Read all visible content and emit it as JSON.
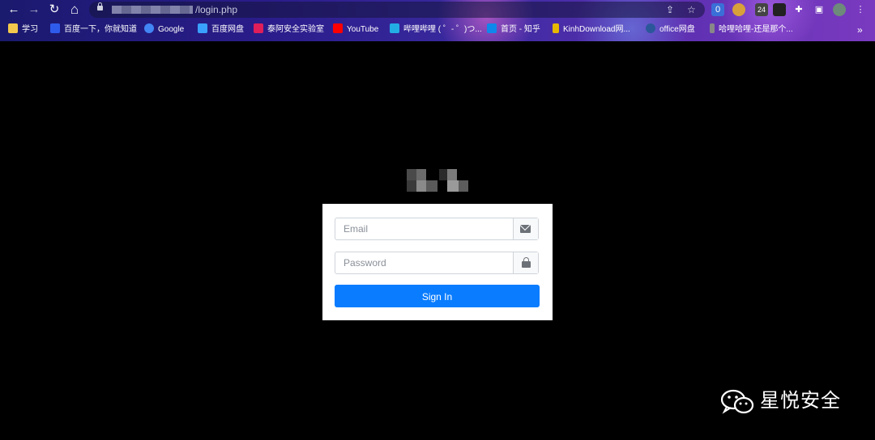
{
  "browser": {
    "nav": {
      "back": "←",
      "forward": "→",
      "reload": "↻",
      "home": "⌂"
    },
    "address_bar": {
      "url_visible_part": "/login.php",
      "security_icon": "lock-icon"
    },
    "toolbar_icons": [
      "share-icon",
      "star-icon"
    ],
    "extensions": [
      {
        "name": "extension-icon-1",
        "badge": "0",
        "color": "#3a6fd8"
      },
      {
        "name": "extension-icon-2",
        "badge": "",
        "color": "#d9a13a"
      },
      {
        "name": "extension-icon-3",
        "badge": "24",
        "color": "#444"
      },
      {
        "name": "extension-icon-4",
        "badge": "",
        "color": "#222"
      },
      {
        "name": "puzzle-icon",
        "badge": "",
        "color": "#ffffff"
      },
      {
        "name": "sidebar-icon",
        "badge": "",
        "color": "#ffffff"
      },
      {
        "name": "profile-avatar",
        "badge": "",
        "color": "#6d8a7a"
      },
      {
        "name": "menu-icon",
        "badge": "",
        "color": "#ffffff"
      }
    ],
    "bookmarks": [
      {
        "label": "学习",
        "icon": "folder-icon",
        "color": "#f2c94c"
      },
      {
        "label": "百度一下，你就知道",
        "icon": "baidu-icon",
        "color": "#2f5bea"
      },
      {
        "label": "Google",
        "icon": "google-icon",
        "color": "#4285f4"
      },
      {
        "label": "百度网盘",
        "icon": "baidu-netdisk-icon",
        "color": "#3aa0ff"
      },
      {
        "label": "泰阿安全实验室",
        "icon": "slack-icon",
        "color": "#e01e5a"
      },
      {
        "label": "YouTube",
        "icon": "youtube-icon",
        "color": "#ff0000"
      },
      {
        "label": "哔哩哔哩 ( ゜- ゜)つ...",
        "icon": "bilibili-icon",
        "color": "#23ade5"
      },
      {
        "label": "首页 - 知乎",
        "icon": "zhihu-icon",
        "color": "#0f88eb"
      },
      {
        "label": "KinhDownload网...",
        "icon": "kinhdownload-icon",
        "color": "#e6b800"
      },
      {
        "label": "office网盘",
        "icon": "office-icon",
        "color": "#2b579a"
      },
      {
        "label": "哈哩哈哩-还是那个...",
        "icon": "halihali-icon",
        "color": "#888888"
      }
    ],
    "bookmarks_overflow": "»"
  },
  "login": {
    "email_placeholder": "Email",
    "password_placeholder": "Password",
    "sign_in_label": "Sign In",
    "accent_color": "#0a7cff"
  },
  "watermark": {
    "text": "星悦安全",
    "icon": "wechat-icon"
  }
}
